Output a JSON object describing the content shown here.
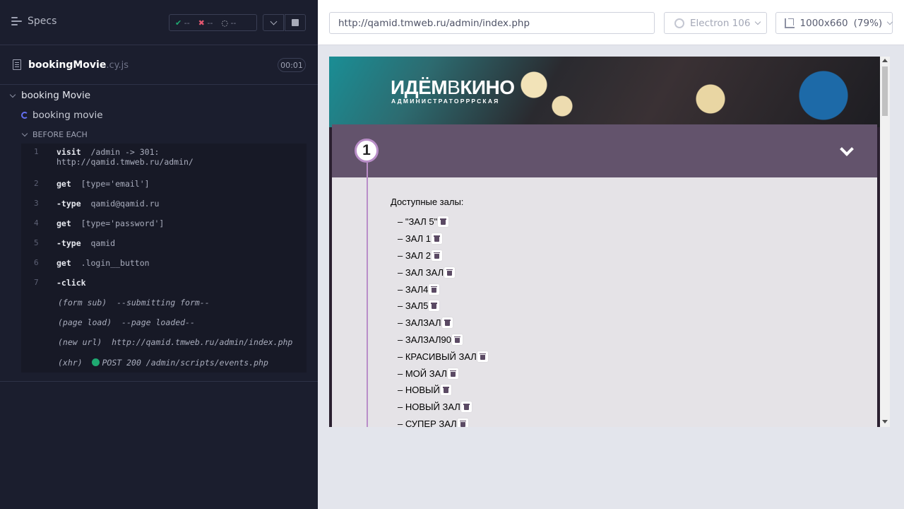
{
  "reporter": {
    "specs_label": "Specs",
    "stats": {
      "passed": "--",
      "failed": "--",
      "pending": "--"
    },
    "spec": {
      "name": "bookingMovie",
      "ext": ".cy.js",
      "duration": "00:01"
    },
    "suite_title": "booking Movie",
    "test_title": "booking movie",
    "hook_title": "BEFORE EACH",
    "commands": [
      {
        "num": "1",
        "name": "visit",
        "msg": "/admin -> 301:",
        "msg2": "http://qamid.tmweb.ru/admin/"
      },
      {
        "num": "2",
        "name": "get",
        "msg": "[type='email']"
      },
      {
        "num": "3",
        "name": "-type",
        "msg": "qamid@qamid.ru"
      },
      {
        "num": "4",
        "name": "get",
        "msg": "[type='password']"
      },
      {
        "num": "5",
        "name": "-type",
        "msg": "qamid"
      },
      {
        "num": "6",
        "name": "get",
        "msg": ".login__button"
      },
      {
        "num": "7",
        "name": "-click",
        "msg": ""
      }
    ],
    "events": [
      {
        "kind": "(form sub)",
        "text": "--submitting form--"
      },
      {
        "kind": "(page load)",
        "text": "--page loaded--"
      },
      {
        "kind": "(new url)",
        "text": "http://qamid.tmweb.ru/admin/index.php"
      },
      {
        "kind": "(xhr)",
        "text": "POST 200 /admin/scripts/events.php"
      }
    ]
  },
  "aut": {
    "url": "http://qamid.tmweb.ru/admin/index.php",
    "browser": "Electron 106",
    "viewport": "1000x660",
    "zoom": "(79%)"
  },
  "app": {
    "logo_main_a": "ИДЁМ",
    "logo_main_b": "В",
    "logo_main_c": "КИНО",
    "logo_sub": "АДМИНИСТРАТОРРРСКАЯ",
    "step_number": "1",
    "halls_title": "Доступные залы:",
    "halls": [
      "– \"ЗАЛ 5\"",
      "– ЗАЛ 1",
      "– ЗАЛ 2",
      "– ЗАЛ ЗАЛ",
      "– ЗАЛ4",
      "– ЗАЛ5",
      "– ЗАЛЗАЛ",
      "– ЗАЛЗАЛ90",
      "– КРАСИВЫЙ ЗАЛ",
      "– МОЙ ЗАЛ",
      "– НОВЫЙ",
      "– НОВЫЙ ЗАЛ",
      "– СУПЕР ЗАЛ"
    ]
  }
}
